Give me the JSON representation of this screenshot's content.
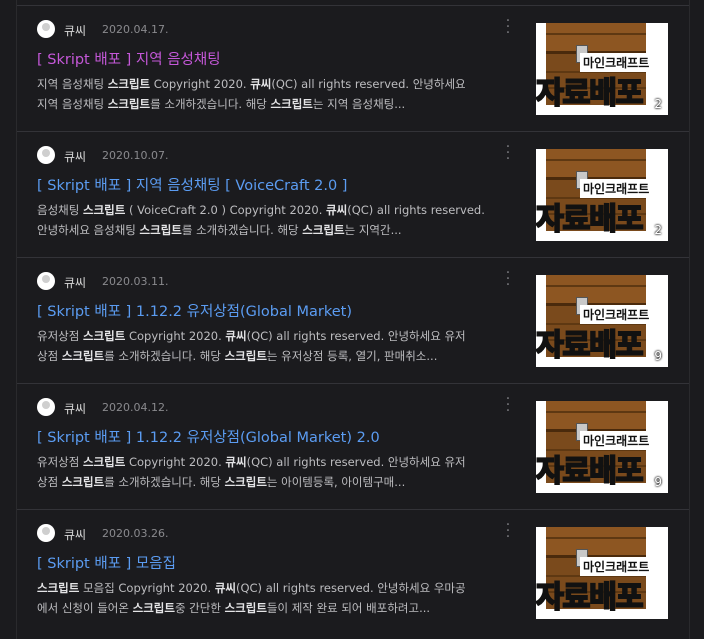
{
  "posts": [
    {
      "author": "큐씨",
      "date": "2020.04.17.",
      "title": "[ Skript 배포 ] 지역 음성채팅",
      "visited": true,
      "excerpt": [
        [
          "지역 음성채팅 ",
          "스크립트",
          " Copyright 2020. ",
          "큐씨",
          "(QC) all rights reserved. 안녕하세요"
        ],
        [
          "지역 음성채팅 ",
          "스크립트",
          "를 소개하겠습니다. 해당 ",
          "스크립트",
          "는 지역 음성채팅..."
        ]
      ],
      "thumb_label": "마인크래프트",
      "thumb_big_white": "자료",
      "thumb_big_green": "배포",
      "comment_count": "2"
    },
    {
      "author": "큐씨",
      "date": "2020.10.07.",
      "title": "[ Skript 배포 ] 지역 음성채팅 [ VoiceCraft 2.0 ]",
      "visited": false,
      "excerpt": [
        [
          "음성채팅 ",
          "스크립트",
          " ( VoiceCraft 2.0 ) Copyright 2020. ",
          "큐씨",
          "(QC) all rights reserved."
        ],
        [
          "안녕하세요 음성채팅 ",
          "스크립트",
          "를 소개하겠습니다. 해당 ",
          "스크립트",
          "는 지역간..."
        ]
      ],
      "thumb_label": "마인크래프트",
      "thumb_big_white": "자료",
      "thumb_big_green": "배포",
      "comment_count": "2"
    },
    {
      "author": "큐씨",
      "date": "2020.03.11.",
      "title": "[ Skript 배포 ] 1.12.2 유저상점(Global Market)",
      "visited": false,
      "excerpt": [
        [
          "유저상점 ",
          "스크립트",
          " Copyright 2020. ",
          "큐씨",
          "(QC) all rights reserved. 안녕하세요 유저"
        ],
        [
          "상점 ",
          "스크립트",
          "를 소개하겠습니다. 해당 ",
          "스크립트",
          "는 유저상점 등록, 열기, 판매취소..."
        ]
      ],
      "thumb_label": "마인크래프트",
      "thumb_big_white": "자료",
      "thumb_big_green": "배포",
      "comment_count": "9"
    },
    {
      "author": "큐씨",
      "date": "2020.04.12.",
      "title": "[ Skript 배포 ] 1.12.2 유저상점(Global Market) 2.0",
      "visited": false,
      "excerpt": [
        [
          "유저상점 ",
          "스크립트",
          " Copyright 2020. ",
          "큐씨",
          "(QC) all rights reserved. 안녕하세요 유저"
        ],
        [
          "상점 ",
          "스크립트",
          "를 소개하겠습니다. 해당 ",
          "스크립트",
          "는 아이템등록, 아이템구매..."
        ]
      ],
      "thumb_label": "마인크래프트",
      "thumb_big_white": "자료",
      "thumb_big_green": "배포",
      "comment_count": "9"
    },
    {
      "author": "큐씨",
      "date": "2020.03.26.",
      "title": "[ Skript 배포 ] 모음집",
      "visited": false,
      "excerpt": [
        [
          "",
          "스크립트",
          " 모음집 Copyright 2020. ",
          "큐씨",
          "(QC) all rights reserved. 안녕하세요 우마공"
        ],
        [
          "에서 신청이 들어온 ",
          "스크립트",
          "중 간단한 ",
          "스크립트",
          "들이 제작 완료 되어 배포하려고..."
        ]
      ],
      "thumb_label": "마인크래프트",
      "thumb_big_white": "자료",
      "thumb_big_green": "배포",
      "comment_count": ""
    }
  ],
  "menu_icon": "more-vertical-icon",
  "colors": {
    "background": "#1b1b1e",
    "link": "#5b9cf2",
    "visited_link": "#c558d9",
    "meta": "#8a8a8e",
    "body": "#bdbdc0"
  }
}
